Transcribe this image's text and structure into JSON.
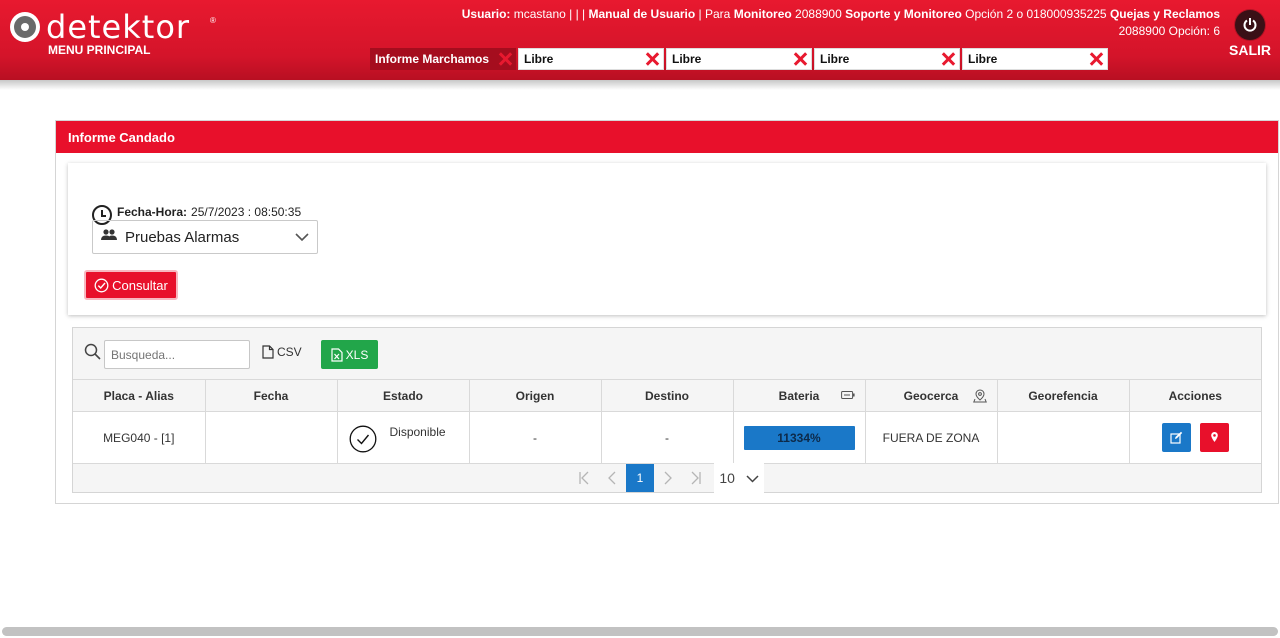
{
  "header": {
    "logo_text": "detektor",
    "logo_reg": "®",
    "menu_label": "MENU PRINCIPAL",
    "user_line": {
      "usuario_label": "Usuario:",
      "usuario_value": "mcastano",
      "separators": "| | |",
      "manual_label": "Manual de Usuario",
      "para_text": "| Para",
      "monitoreo_label": "Monitoreo",
      "monitoreo_phone": "2088900",
      "soporte_label": "Soporte y Monitoreo",
      "soporte_text": "Opción 2 o 018000935225",
      "quejas_label": "Quejas y Reclamos",
      "line2": "2088900 Opción: 6"
    },
    "exit_label": "SALIR"
  },
  "tabs": [
    {
      "label": "Informe Marchamos",
      "active": true
    },
    {
      "label": "Libre",
      "active": false
    },
    {
      "label": "Libre",
      "active": false
    },
    {
      "label": "Libre",
      "active": false
    },
    {
      "label": "Libre",
      "active": false
    }
  ],
  "panel": {
    "title": "Informe Candado",
    "fecha_label": "Fecha-Hora:",
    "fecha_value": "25/7/2023 : 08:50:35",
    "group_selected": "Pruebas Alarmas",
    "consultar_label": "Consultar"
  },
  "grid": {
    "search_placeholder": "Busqueda...",
    "csv_label": "CSV",
    "xls_label": "XLS",
    "columns": [
      "Placa - Alias",
      "Fecha",
      "Estado",
      "Origen",
      "Destino",
      "Bateria",
      "Geocerca",
      "Georefencia",
      "Acciones"
    ],
    "rows": [
      {
        "placa": "MEG040 - [1]",
        "fecha": "",
        "estado": "Disponible",
        "origen": "-",
        "destino": "-",
        "bateria": "11334%",
        "geocerca": "FUERA DE ZONA",
        "georefencia": ""
      }
    ],
    "pager": {
      "current_page": "1",
      "page_size": "10"
    }
  },
  "colors": {
    "brand_red": "#e8102b",
    "header_red": "#d4142a",
    "blue": "#1a78c8",
    "green": "#22a64a"
  }
}
